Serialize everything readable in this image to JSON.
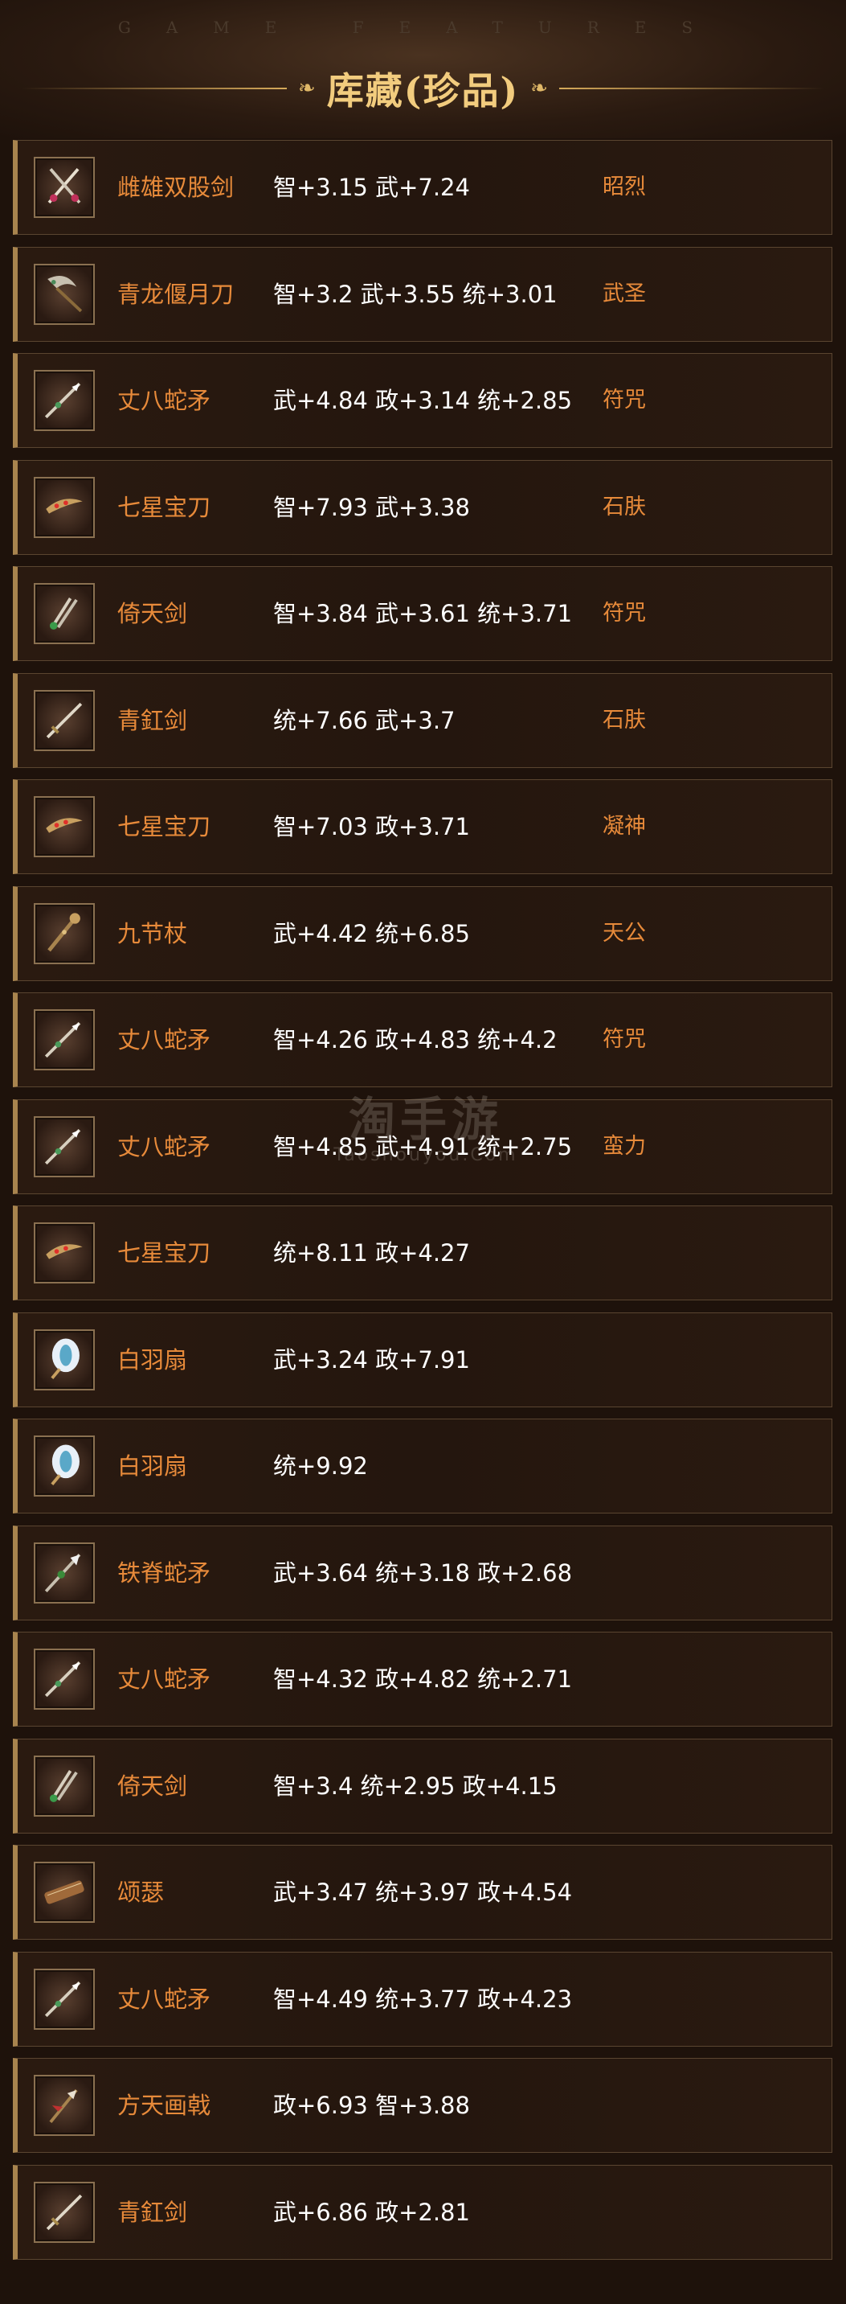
{
  "header": {
    "faint_text": "GAME FEATURES",
    "title": "库藏(珍品)",
    "ornament_left": "❧",
    "ornament_right": "❧"
  },
  "watermark": {
    "main": "淘手游",
    "sub": "Taoshouyou.Com"
  },
  "items": [
    {
      "name": "雌雄双股剑",
      "stats": "智+3.15 武+7.24",
      "skill": "昭烈",
      "icon": "twin-swords-icon"
    },
    {
      "name": "青龙偃月刀",
      "stats": "智+3.2 武+3.55 统+3.01",
      "skill": "武圣",
      "icon": "crescent-blade-icon"
    },
    {
      "name": "丈八蛇矛",
      "stats": "武+4.84 政+3.14 统+2.85",
      "skill": "符咒",
      "icon": "serpent-spear-icon"
    },
    {
      "name": "七星宝刀",
      "stats": "智+7.93 武+3.38",
      "skill": "石肤",
      "icon": "seven-star-sabre-icon"
    },
    {
      "name": "倚天剑",
      "stats": "智+3.84 武+3.61 统+3.71",
      "skill": "符咒",
      "icon": "heaven-sword-icon"
    },
    {
      "name": "青釭剑",
      "stats": "统+7.66 武+3.7",
      "skill": "石肤",
      "icon": "green-sword-icon"
    },
    {
      "name": "七星宝刀",
      "stats": "智+7.03 政+3.71",
      "skill": "凝神",
      "icon": "seven-star-sabre-icon"
    },
    {
      "name": "九节杖",
      "stats": "武+4.42 统+6.85",
      "skill": "天公",
      "icon": "nine-section-staff-icon"
    },
    {
      "name": "丈八蛇矛",
      "stats": "智+4.26 政+4.83 统+4.2",
      "skill": "符咒",
      "icon": "serpent-spear-icon"
    },
    {
      "name": "丈八蛇矛",
      "stats": "智+4.85 武+4.91 统+2.75",
      "skill": "蛮力",
      "icon": "serpent-spear-icon"
    },
    {
      "name": "七星宝刀",
      "stats": "统+8.11 政+4.27",
      "skill": "",
      "icon": "seven-star-sabre-icon"
    },
    {
      "name": "白羽扇",
      "stats": "武+3.24 政+7.91",
      "skill": "",
      "icon": "feather-fan-icon"
    },
    {
      "name": "白羽扇",
      "stats": "统+9.92",
      "skill": "",
      "icon": "feather-fan-icon"
    },
    {
      "name": "铁脊蛇矛",
      "stats": "武+3.64 统+3.18 政+2.68",
      "skill": "",
      "icon": "iron-spine-spear-icon"
    },
    {
      "name": "丈八蛇矛",
      "stats": "智+4.32 政+4.82 统+2.71",
      "skill": "",
      "icon": "serpent-spear-icon"
    },
    {
      "name": "倚天剑",
      "stats": "智+3.4 统+2.95 政+4.15",
      "skill": "",
      "icon": "heaven-sword-icon"
    },
    {
      "name": "颂瑟",
      "stats": "武+3.47 统+3.97 政+4.54",
      "skill": "",
      "icon": "zither-icon"
    },
    {
      "name": "丈八蛇矛",
      "stats": "智+4.49 统+3.77 政+4.23",
      "skill": "",
      "icon": "serpent-spear-icon"
    },
    {
      "name": "方天画戟",
      "stats": "政+6.93 智+3.88",
      "skill": "",
      "icon": "halberd-icon"
    },
    {
      "name": "青釭剑",
      "stats": "武+6.86 政+2.81",
      "skill": "",
      "icon": "green-sword-icon"
    }
  ]
}
